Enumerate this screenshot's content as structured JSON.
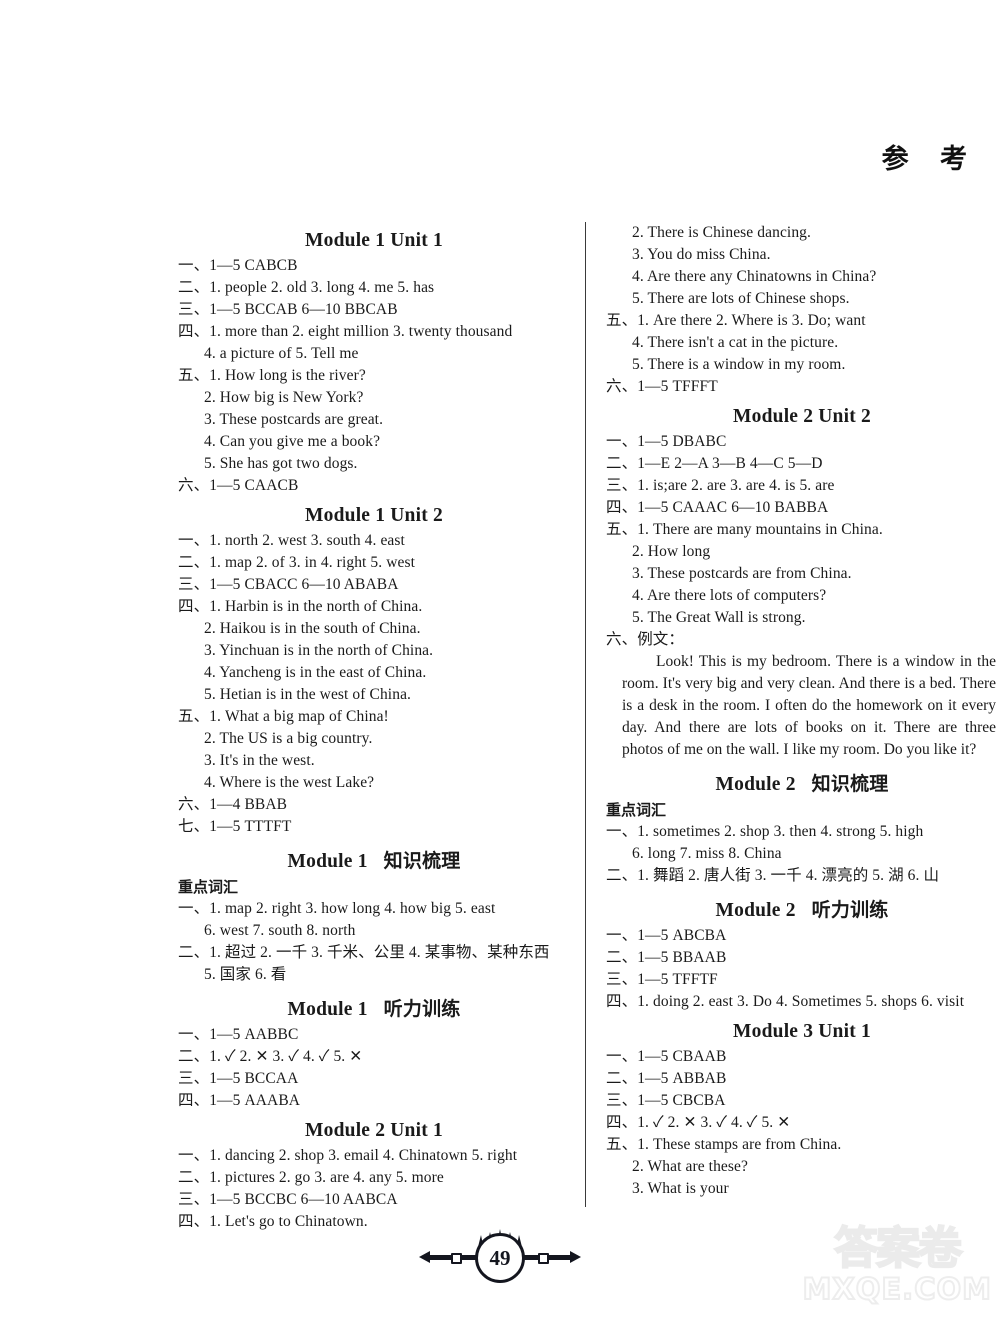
{
  "header": {
    "title": "参  考"
  },
  "page_number": "49",
  "watermark": {
    "cn": "答案卷",
    "url": "MXQE.COM"
  },
  "left_column": [
    {
      "type": "heading",
      "text": "Module 1 Unit 1"
    },
    {
      "type": "line",
      "text": "一、1—5   CABCB"
    },
    {
      "type": "line",
      "text": "二、1. people   2. old   3. long   4. me   5. has"
    },
    {
      "type": "line",
      "text": "三、1—5   BCCAB   6—10   BBCAB"
    },
    {
      "type": "line",
      "text": "四、1. more than   2. eight million   3. twenty thousand"
    },
    {
      "type": "line",
      "indent": true,
      "text": "4. a picture of   5. Tell me"
    },
    {
      "type": "line",
      "text": "五、1. How long is the river?"
    },
    {
      "type": "line",
      "indent": true,
      "text": "2. How big is New York?"
    },
    {
      "type": "line",
      "indent": true,
      "text": "3. These postcards are great."
    },
    {
      "type": "line",
      "indent": true,
      "text": "4. Can you give me a book?"
    },
    {
      "type": "line",
      "indent": true,
      "text": "5. She has got two dogs."
    },
    {
      "type": "line",
      "text": "六、1—5   CAACB"
    },
    {
      "type": "heading",
      "text": "Module 1 Unit 2"
    },
    {
      "type": "line",
      "text": "一、1. north   2. west   3. south   4. east"
    },
    {
      "type": "line",
      "text": "二、1. map   2. of   3. in   4. right   5. west"
    },
    {
      "type": "line",
      "text": "三、1—5   CBACC   6—10   ABABA"
    },
    {
      "type": "line",
      "text": "四、1. Harbin is in the north of China."
    },
    {
      "type": "line",
      "indent": true,
      "text": "2. Haikou is in the south of China."
    },
    {
      "type": "line",
      "indent": true,
      "text": "3. Yinchuan is in the north of China."
    },
    {
      "type": "line",
      "indent": true,
      "text": "4. Yancheng is in the east of China."
    },
    {
      "type": "line",
      "indent": true,
      "text": "5. Hetian is in the west of China."
    },
    {
      "type": "line",
      "text": "五、1. What a big map of China!"
    },
    {
      "type": "line",
      "indent": true,
      "text": "2. The US is a big country."
    },
    {
      "type": "line",
      "indent": true,
      "text": "3. It's in the west."
    },
    {
      "type": "line",
      "indent": true,
      "text": "4. Where is the west Lake?"
    },
    {
      "type": "line",
      "text": "六、1—4   BBAB"
    },
    {
      "type": "line",
      "text": "七、1—5   TTTFT"
    },
    {
      "type": "heading",
      "en": "Module 1",
      "cn": "知识梳理"
    },
    {
      "type": "subhead",
      "text": "重点词汇"
    },
    {
      "type": "line",
      "text": "一、1. map   2. right   3. how long   4. how big   5. east"
    },
    {
      "type": "line",
      "indent": true,
      "text": "6. west   7. south   8. north"
    },
    {
      "type": "line",
      "text": "二、1. 超过   2. 一千   3. 千米、公里   4. 某事物、某种东西"
    },
    {
      "type": "line",
      "indent": true,
      "text": "5. 国家   6. 看"
    },
    {
      "type": "heading",
      "en": "Module 1",
      "cn": "听力训练"
    },
    {
      "type": "line",
      "text": "一、1—5   AABBC"
    },
    {
      "type": "line",
      "text": "二、1. ✓   2. ✕   3. ✓   4. ✓   5. ✕"
    },
    {
      "type": "line",
      "text": "三、1—5   BCCAA"
    },
    {
      "type": "line",
      "text": "四、1—5   AAABA"
    },
    {
      "type": "heading",
      "text": "Module 2 Unit 1"
    },
    {
      "type": "line",
      "text": "一、1. dancing   2. shop   3. email   4. Chinatown   5. right"
    },
    {
      "type": "line",
      "text": "二、1. pictures   2. go   3. are   4. any   5. more"
    },
    {
      "type": "line",
      "text": "三、1—5   BCCBC   6—10   AABCA"
    },
    {
      "type": "line",
      "text": "四、1. Let's go to Chinatown."
    }
  ],
  "right_column": [
    {
      "type": "line",
      "indent": true,
      "text": "2. There is Chinese dancing."
    },
    {
      "type": "line",
      "indent": true,
      "text": "3. You do miss China."
    },
    {
      "type": "line",
      "indent": true,
      "text": "4. Are there any Chinatowns in China?"
    },
    {
      "type": "line",
      "indent": true,
      "text": "5. There are lots of Chinese shops."
    },
    {
      "type": "line",
      "text": "五、1. Are there   2. Where is   3. Do; want"
    },
    {
      "type": "line",
      "indent": true,
      "text": "4. There isn't a cat in the picture."
    },
    {
      "type": "line",
      "indent": true,
      "text": "5. There is a window in my room."
    },
    {
      "type": "line",
      "text": "六、1—5   TFFFT"
    },
    {
      "type": "heading",
      "text": "Module 2 Unit 2"
    },
    {
      "type": "line",
      "text": "一、1—5   DBABC"
    },
    {
      "type": "line",
      "text": "二、1—E   2—A   3—B   4—C   5—D"
    },
    {
      "type": "line",
      "text": "三、1. is;are   2. are   3. are   4. is   5. are"
    },
    {
      "type": "line",
      "text": "四、1—5   CAAAC   6—10   BABBA"
    },
    {
      "type": "line",
      "text": "五、1. There are many mountains in China."
    },
    {
      "type": "line",
      "indent": true,
      "text": "2. How long"
    },
    {
      "type": "line",
      "indent": true,
      "text": "3. These postcards are from China."
    },
    {
      "type": "line",
      "indent": true,
      "text": "4. Are there lots of computers?"
    },
    {
      "type": "line",
      "indent": true,
      "text": "5. The Great Wall is strong."
    },
    {
      "type": "line",
      "text": "六、例文："
    },
    {
      "type": "essay",
      "text": "Look! This is my bedroom. There is a window in the room. It's very big and very clean. And there is a bed. There is a desk in the room. I often do the homework on it every day. And there are lots of books on it. There are three photos of me on the wall. I like my room. Do you like it?"
    },
    {
      "type": "heading",
      "en": "Module 2",
      "cn": "知识梳理"
    },
    {
      "type": "subhead",
      "text": "重点词汇"
    },
    {
      "type": "line",
      "text": "一、1. sometimes   2. shop   3. then   4. strong   5. high"
    },
    {
      "type": "line",
      "indent": true,
      "text": "6. long   7. miss   8. China"
    },
    {
      "type": "line",
      "text": "二、1. 舞蹈   2. 唐人街   3. 一千   4. 漂亮的   5. 湖   6. 山"
    },
    {
      "type": "heading",
      "en": "Module 2",
      "cn": "听力训练"
    },
    {
      "type": "line",
      "text": "一、1—5   ABCBA"
    },
    {
      "type": "line",
      "text": "二、1—5   BBAAB"
    },
    {
      "type": "line",
      "text": "三、1—5   TFFTF"
    },
    {
      "type": "line",
      "text": "四、1. doing   2. east   3. Do   4. Sometimes   5. shops   6. visit"
    },
    {
      "type": "heading",
      "text": "Module 3 Unit 1"
    },
    {
      "type": "line",
      "text": "一、1—5   CBAAB"
    },
    {
      "type": "line",
      "text": "二、1—5   ABBAB"
    },
    {
      "type": "line",
      "text": "三、1—5   CBCBA"
    },
    {
      "type": "line",
      "text": "四、1. ✓   2. ✕   3. ✓   4. ✓   5. ✕"
    },
    {
      "type": "line",
      "text": "五、1. These stamps are from China."
    },
    {
      "type": "line",
      "indent": true,
      "text": "2. What are these?"
    },
    {
      "type": "line",
      "indent": true,
      "text": "3. What is your"
    }
  ]
}
